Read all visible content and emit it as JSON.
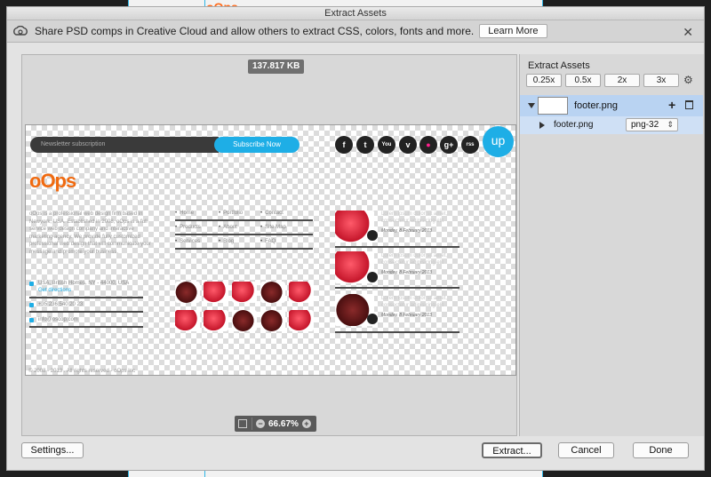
{
  "background": {
    "logo_text": "oOps"
  },
  "window": {
    "title": "Extract Assets"
  },
  "infobar": {
    "icon": "creative-cloud-icon",
    "message": "Share PSD comps in Creative Cloud and allow others to extract CSS, colors, fonts and more.",
    "learn_more_label": "Learn More"
  },
  "preview": {
    "file_size": "137.817 KB",
    "zoom_level": "66.67%",
    "canvas": {
      "newsletter_placeholder": "Newsletter subscription",
      "subscribe_label": "Subscribe Now",
      "social": [
        "f",
        "t",
        "You",
        "v",
        "●",
        "g+",
        "rss"
      ],
      "up_label": "up",
      "logo": "oOps",
      "about_text": "oOps is a professional web design firm based in Newyork, USA. Established in 2008, oOps is a full service web design company and interactive marketing agency. We provide fully customized professional web design that will communicate your message and promote your business.",
      "address": "USA, British Homes, NY - 44000, USA",
      "directions": "Get directions",
      "phone": "+35 236 540 20 23",
      "email": "info@oscop.com",
      "nav": [
        "Home",
        "Portfolio",
        "Contact",
        "Products",
        "About",
        "Site Map",
        "Services",
        "Blog",
        "FAQ"
      ],
      "posts": [
        {
          "title": "Lorem ipsum dolor sit amet, consectetur adipisicing elit",
          "date": "Monday, 8 February 2013"
        },
        {
          "title": "Lorem ipsum dolor sit amet, consectetur adipisicing elit",
          "date": "Monday, 8 February 2013"
        },
        {
          "title": "Lorem ipsum dolor sit amet, consectetur adipisicing elit",
          "date": "Monday, 8 February 2013"
        }
      ],
      "copyright": "© 2008 - 2013 . All rights reserved - oOps Inc"
    }
  },
  "side_panel": {
    "title": "Extract Assets",
    "scales": [
      "0.25x",
      "0.5x",
      "2x",
      "3x"
    ],
    "asset": {
      "name": "footer.png",
      "sub_name": "footer.png",
      "format": "png-32"
    }
  },
  "footer": {
    "settings_label": "Settings...",
    "extract_label": "Extract...",
    "cancel_label": "Cancel",
    "done_label": "Done"
  }
}
